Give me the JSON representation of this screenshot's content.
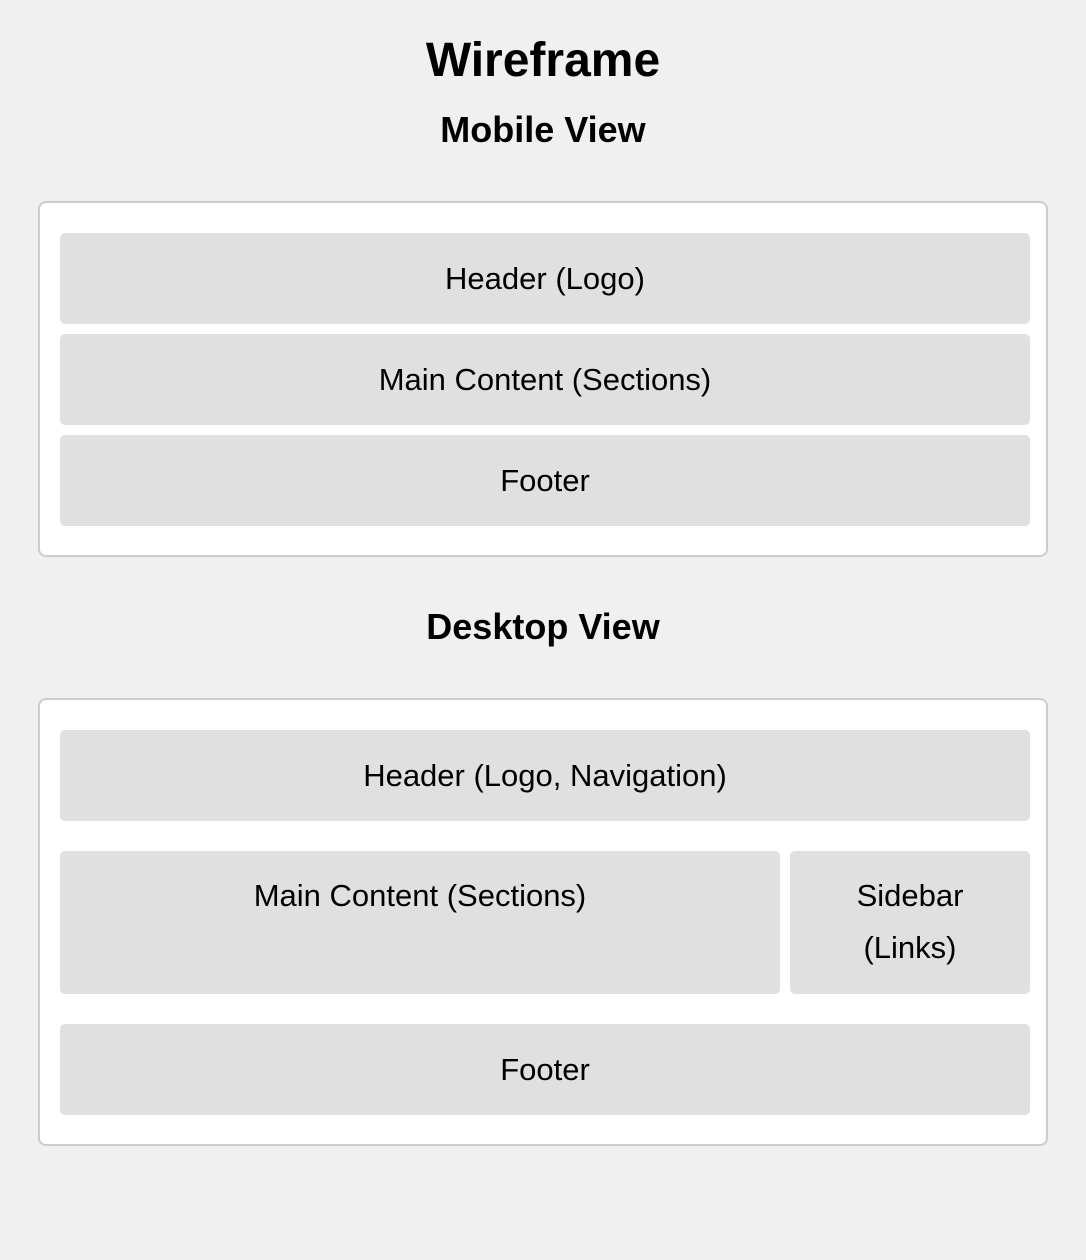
{
  "title": "Wireframe",
  "mobile": {
    "heading": "Mobile View",
    "header": "Header (Logo)",
    "main": "Main Content (Sections)",
    "footer": "Footer"
  },
  "desktop": {
    "heading": "Desktop View",
    "header": "Header (Logo, Navigation)",
    "main": "Main Content (Sections)",
    "sidebar": "Sidebar (Links)",
    "footer": "Footer"
  },
  "colors": {
    "background": "#f0f0f0",
    "frame": "#ffffff",
    "frame_border": "#cccccc",
    "block": "#e0e0e0"
  }
}
